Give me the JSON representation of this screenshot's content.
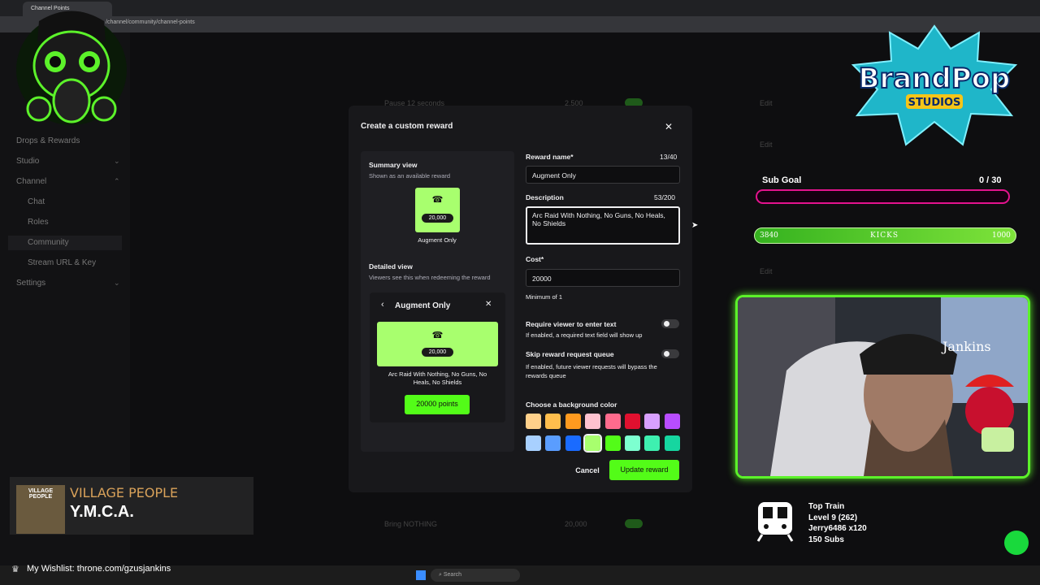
{
  "browser": {
    "tab_title": "Channel Points",
    "url": "/channel/community/channel-points"
  },
  "sidebar": {
    "items": [
      {
        "label": "Drops & Rewards"
      },
      {
        "label": "Studio"
      },
      {
        "label": "Channel"
      },
      {
        "label": "Chat"
      },
      {
        "label": "Roles"
      },
      {
        "label": "Community"
      },
      {
        "label": "Stream URL & Key"
      },
      {
        "label": "Settings"
      }
    ]
  },
  "background_rewards": [
    {
      "name": "Pause 12 seconds",
      "cost": "2,500",
      "edit": "Edit"
    },
    {
      "name": "Bring NOTHING",
      "cost": "20,000",
      "edit": "Edit"
    }
  ],
  "background_edit_label": "Edit",
  "modal": {
    "title": "Create a custom reward",
    "summary_title": "Summary view",
    "summary_sub": "Shown as an available reward",
    "tile_cost": "20,000",
    "tile_name": "Augment Only",
    "detailed_title": "Detailed view",
    "detailed_sub": "Viewers see this when redeeming the reward",
    "detail_header": "Augment Only",
    "detail_cost": "20,000",
    "detail_desc": "Arc Raid With Nothing, No Guns, No Heals, No Shields",
    "points_button": "20000 points",
    "reward_name_label": "Reward name*",
    "reward_name_count": "13/40",
    "reward_name_value": "Augment Only",
    "description_label": "Description",
    "description_count": "53/200",
    "description_value": "Arc Raid With Nothing, No Guns, No Heals, No Shields",
    "cost_label": "Cost*",
    "cost_value": "20000",
    "cost_hint": "Minimum of 1",
    "require_text_label": "Require viewer to enter text",
    "require_text_hint": "If enabled, a required text field will show up",
    "skip_queue_label": "Skip reward request queue",
    "skip_queue_hint": "If enabled, future viewer requests will bypass the rewards queue",
    "bg_color_label": "Choose a background color",
    "swatches": [
      "#ffd08a",
      "#ffbe4d",
      "#ff9a1f",
      "#ffc2cf",
      "#ff6b8d",
      "#e0102f",
      "#d8a0ff",
      "#b84dff",
      "#a8d0ff",
      "#5a9dff",
      "#1a6bff",
      "#a8ff6e",
      "#53fc18",
      "#7dffd0",
      "#3ef0b0",
      "#16d6a0"
    ],
    "selected_swatch_index": 11,
    "cancel": "Cancel",
    "update": "Update reward"
  },
  "overlay": {
    "brand_line1": "BrandPop",
    "brand_line2": "STUDIOS",
    "subgoal_label": "Sub Goal",
    "subgoal_count": "0 / 30",
    "kicks_left": "3840",
    "kicks_mid": "KICKS",
    "kicks_right": "1000",
    "train_title": "Top Train",
    "train_level": "Level 9  (262)",
    "train_user": "Jerry6486 x120",
    "train_subs": "150 Subs",
    "music_artist": "VILLAGE PEOPLE",
    "music_title": "Y.M.C.A.",
    "album_text": "VILLAGE PEOPLE",
    "cap_text": "Jankins",
    "wishlist": "My Wishlist: throne.com/gzusjankins"
  },
  "taskbar": {
    "search_placeholder": "Search"
  }
}
